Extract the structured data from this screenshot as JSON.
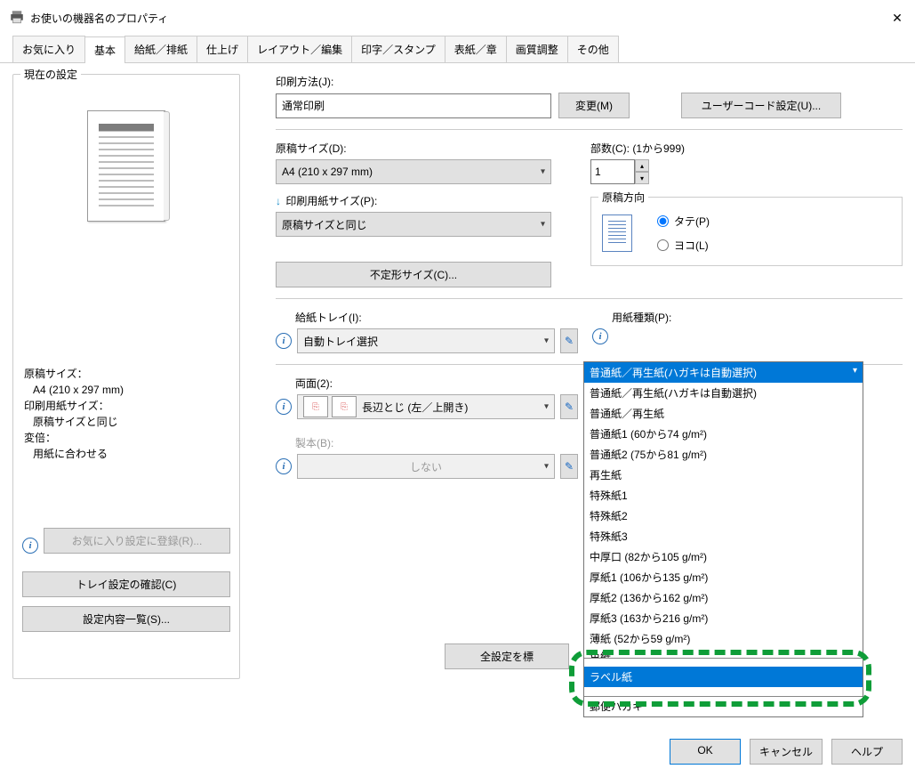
{
  "title": "お使いの機器名のプロパティ",
  "tabs": [
    "お気に入り",
    "基本",
    "給紙／排紙",
    "仕上げ",
    "レイアウト／編集",
    "印字／スタンプ",
    "表紙／章",
    "画質調整",
    "その他"
  ],
  "active_tab": "基本",
  "left": {
    "group_title": "現在の設定",
    "info1_label": "原稿サイズ：",
    "info1_value": "A4 (210 x 297 mm)",
    "info2_label": "印刷用紙サイズ：",
    "info2_value": "原稿サイズと同じ",
    "info3_label": "変倍：",
    "info3_value": "用紙に合わせる",
    "fav_btn": "お気に入り設定に登録(R)...",
    "tray_btn": "トレイ設定の確認(C)",
    "list_btn": "設定内容一覧(S)..."
  },
  "right": {
    "print_method_label": "印刷方法(J):",
    "print_method_value": "通常印刷",
    "change_btn": "変更(M)",
    "usercode_btn": "ユーザーコード設定(U)...",
    "doc_size_label": "原稿サイズ(D):",
    "doc_size_value": "A4 (210 x 297 mm)",
    "print_paper_label": "印刷用紙サイズ(P):",
    "print_paper_value": "原稿サイズと同じ",
    "custom_size_btn": "不定形サイズ(C)...",
    "copies_label": "部数(C): (1から999)",
    "copies_value": "1",
    "orient_label": "原稿方向",
    "orient_portrait": "タテ(P)",
    "orient_landscape": "ヨコ(L)",
    "tray_label": "給紙トレイ(I):",
    "tray_value": "自動トレイ選択",
    "paper_type_label": "用紙種類(P):",
    "paper_type_selected": "普通紙／再生紙(ハガキは自動選択)",
    "duplex_label": "両面(2):",
    "duplex_value": "長辺とじ (左／上開き)",
    "booklet_label": "製本(B):",
    "booklet_value": "しない",
    "reset_btn": "全設定を標",
    "partial_below": "郵便ハカキ",
    "paper_options": [
      "普通紙／再生紙(ハガキは自動選択)",
      "普通紙／再生紙",
      "普通紙1 (60から74 g/m²)",
      "普通紙2 (75から81 g/m²)",
      "再生紙",
      "特殊紙1",
      "特殊紙2",
      "特殊紙3",
      "中厚口 (82から105 g/m²)",
      "厚紙1 (106から135 g/m²)",
      "厚紙2 (136から162 g/m²)",
      "厚紙3 (163から216 g/m²)",
      "薄紙 (52から59 g/m²)",
      "色紙"
    ],
    "highlighted_option": "ラベル紙"
  },
  "buttons": {
    "ok": "OK",
    "cancel": "キャンセル",
    "help": "ヘルプ"
  }
}
